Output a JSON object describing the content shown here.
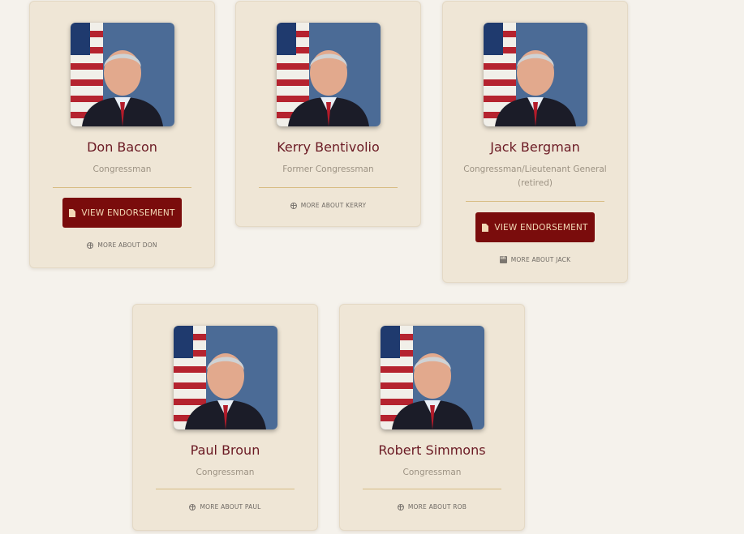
{
  "colors": {
    "page_bg": "#f5f2ec",
    "card_bg": "#efe6d6",
    "name": "#6b1a24",
    "button_bg": "#7a0c0c",
    "button_text": "#f2d9b6",
    "divider": "#d7bc83"
  },
  "cards": [
    {
      "name": "Don Bacon",
      "title": "Congressman",
      "button_label": "VIEW ENDORSEMENT",
      "button_icon": "document-icon",
      "more_label": "MORE ABOUT DON",
      "more_icon": "globe-icon"
    },
    {
      "name": "Kerry Bentivolio",
      "title": "Former Congressman",
      "more_label": "MORE ABOUT KERRY",
      "more_icon": "globe-icon"
    },
    {
      "name": "Jack Bergman",
      "title": "Congressman/Lieutenant General (retired)",
      "button_label": "VIEW ENDORSEMENT",
      "button_icon": "document-icon",
      "more_label": "MORE ABOUT JACK",
      "more_icon": "linkedin-icon"
    },
    {
      "name": "Paul Broun",
      "title": "Congressman",
      "more_label": "MORE ABOUT PAUL",
      "more_icon": "globe-icon"
    },
    {
      "name": "Robert Simmons",
      "title": "Congressman",
      "more_label": "MORE ABOUT ROB",
      "more_icon": "globe-icon"
    }
  ]
}
